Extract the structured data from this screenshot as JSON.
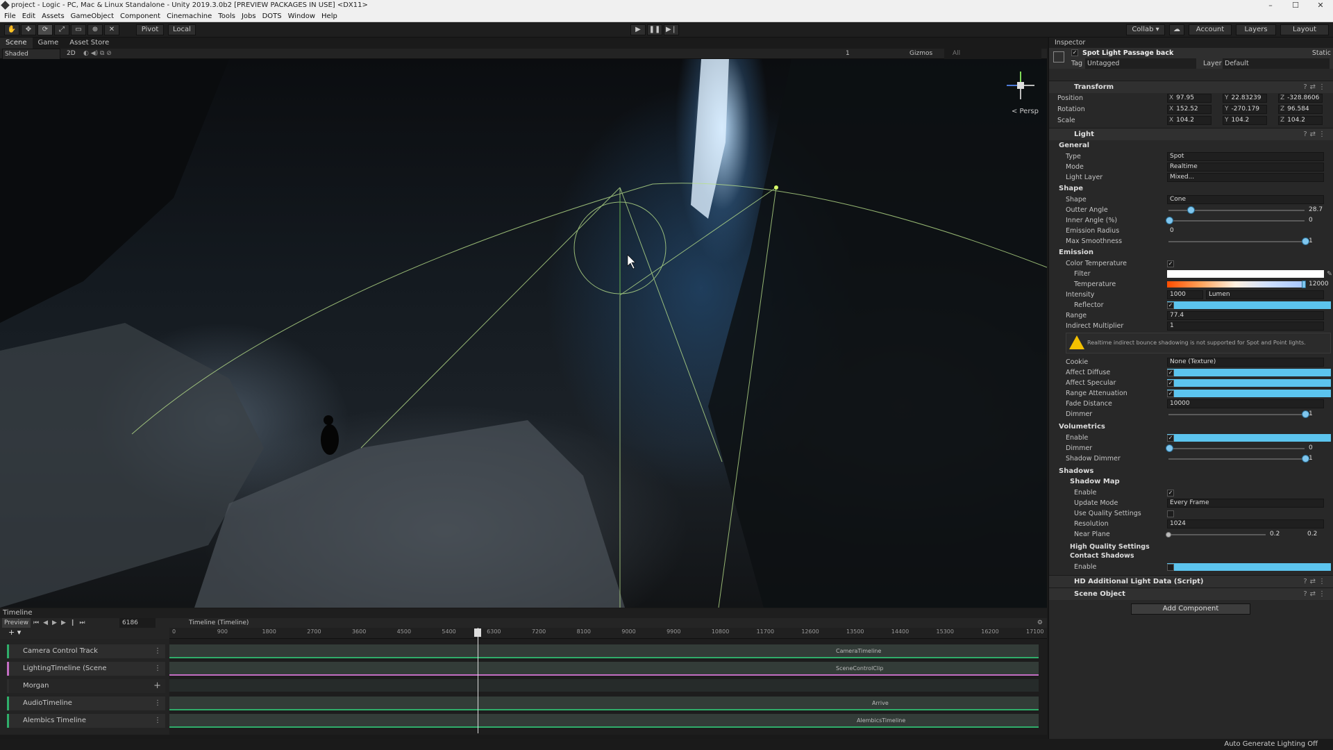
{
  "window": {
    "title": "project - Logic - PC, Mac & Linux Standalone - Unity 2019.3.0b2 [PREVIEW PACKAGES IN USE] <DX11>",
    "minimize": "–",
    "maximize": "☐",
    "close": "✕"
  },
  "menu": [
    "File",
    "Edit",
    "Assets",
    "GameObject",
    "Component",
    "Cinemachine",
    "Tools",
    "Jobs",
    "DOTS",
    "Window",
    "Help"
  ],
  "toolbar": {
    "tools": [
      "hand-tool",
      "move-tool",
      "rotate-tool",
      "scale-tool",
      "rect-tool",
      "transform-tool",
      "custom-tool"
    ],
    "pivot": "Pivot",
    "local": "Local",
    "play": "▶",
    "pause": "❚❚",
    "step": "▶❘",
    "collab": "Collab ▾",
    "cloud": "☁",
    "account": "Account",
    "layers": "Layers",
    "layout": "Layout"
  },
  "scene_tabs": [
    "Scene",
    "Game",
    "Asset Store"
  ],
  "scene_toolbar": {
    "shading": "Shaded",
    "mode_2d": "2D",
    "gizmos": "Gizmos",
    "search_placeholder": "All",
    "layer_count": "1"
  },
  "scene": {
    "persp_label": "< Persp"
  },
  "timeline": {
    "tab": "Timeline",
    "preview": "Preview",
    "frame": "6186",
    "asset": "Timeline (Timeline)",
    "ruler_ticks": [
      "0",
      "900",
      "1800",
      "2700",
      "3600",
      "4500",
      "5400",
      "6300",
      "7200",
      "8100",
      "9000",
      "9900",
      "10800",
      "11700",
      "12600",
      "13500",
      "14400",
      "15300",
      "16200",
      "17100"
    ],
    "tracks": [
      {
        "name": "Camera Control Track",
        "clip": "CameraTimeline"
      },
      {
        "name": "LightingTimeline (Scene",
        "clip": "SceneControlClip"
      },
      {
        "name": "Morgan",
        "clip": ""
      },
      {
        "name": "AudioTimeline",
        "clip": "Arrive"
      },
      {
        "name": "Alembics Timeline",
        "clip": "AlembicsTimeline"
      }
    ]
  },
  "status": {
    "lighting": "Auto Generate Lighting Off"
  },
  "inspector": {
    "tab": "Inspector",
    "object_name": "Spot Light Passage back",
    "static_label": "Static",
    "tag_label": "Tag",
    "tag_value": "Untagged",
    "layer_label": "Layer",
    "layer_value": "Default",
    "transform": {
      "title": "Transform",
      "position": {
        "label": "Position",
        "x": "97.95",
        "y": "22.83239",
        "z": "-328.8606"
      },
      "rotation": {
        "label": "Rotation",
        "x": "152.52",
        "y": "-270.179",
        "z": "96.584"
      },
      "scale": {
        "label": "Scale",
        "x": "104.2",
        "y": "104.2",
        "z": "104.2"
      }
    },
    "light": {
      "title": "Light",
      "general": "General",
      "type_label": "Type",
      "type_value": "Spot",
      "mode_label": "Mode",
      "mode_value": "Realtime",
      "light_layer_label": "Light Layer",
      "light_layer_value": "Mixed...",
      "shape_section": "Shape",
      "shape_label": "Shape",
      "shape_value": "Cone",
      "outter_angle_label": "Outter Angle",
      "outter_angle_value": "28.7",
      "outter_angle_fraction": 0.16,
      "inner_angle_label": "Inner Angle (%)",
      "inner_angle_value": "0",
      "inner_angle_fraction": 0.0,
      "emission_radius_label": "Emission Radius",
      "emission_radius_value": "0",
      "max_smoothness_label": "Max Smoothness",
      "max_smoothness_value": "1",
      "max_smoothness_fraction": 1.0,
      "emission_section": "Emission",
      "color_temperature_label": "Color Temperature",
      "filter_label": "Filter",
      "temperature_label": "Temperature",
      "temperature_value": "12000",
      "intensity_label": "Intensity",
      "intensity_value": "1000",
      "intensity_unit": "Lumen",
      "reflector_label": "Reflector",
      "range_label": "Range",
      "range_value": "77.4",
      "indirect_label": "Indirect Multiplier",
      "indirect_value": "1",
      "warning": "Realtime indirect bounce shadowing is not supported for Spot and Point lights.",
      "cookie_label": "Cookie",
      "cookie_value": "None (Texture)",
      "affect_diffuse_label": "Affect Diffuse",
      "affect_specular_label": "Affect Specular",
      "range_attenuation_label": "Range Attenuation",
      "fade_distance_label": "Fade Distance",
      "fade_distance_value": "10000",
      "dimmer_label": "Dimmer",
      "dimmer_value": "1",
      "dimmer_fraction": 1.0,
      "volumetrics_section": "Volumetrics",
      "vol_enable_label": "Enable",
      "vol_dimmer_label": "Dimmer",
      "vol_dimmer_value": "0",
      "vol_dimmer_fraction": 0.0,
      "shadow_dimmer_label": "Shadow Dimmer",
      "shadow_dimmer_value": "1",
      "shadow_dimmer_fraction": 1.0,
      "shadows_section": "Shadows",
      "shadow_map_section": "Shadow Map",
      "sm_enable_label": "Enable",
      "update_mode_label": "Update Mode",
      "update_mode_value": "Every Frame",
      "use_quality_label": "Use Quality Settings",
      "resolution_label": "Resolution",
      "resolution_value": "1024",
      "near_plane_label": "Near Plane",
      "near_plane_value": "0.2",
      "near_plane_fraction": 0.0,
      "hq_settings": "High Quality Settings",
      "contact_shadows": "Contact Shadows",
      "cs_enable_label": "Enable"
    },
    "hd_additional": "HD Additional Light Data (Script)",
    "scene_object": "Scene Object",
    "add_component": "Add Component"
  },
  "colors": {
    "accent": "#5cc4ee",
    "track_green": "#2fae6a",
    "warning": "#f3c000"
  }
}
